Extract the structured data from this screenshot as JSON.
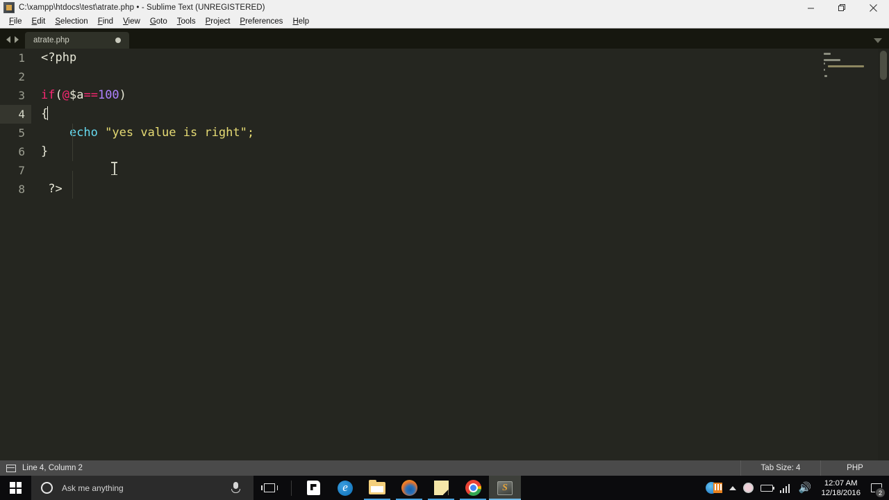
{
  "window": {
    "title": "C:\\xampp\\htdocs\\test\\atrate.php • - Sublime Text (UNREGISTERED)",
    "icon": "sublime-app-icon",
    "controls": {
      "minimize": "minimize-icon",
      "restore": "restore-icon",
      "close": "close-icon"
    }
  },
  "menu": {
    "items": [
      {
        "label": "File",
        "accel": "F",
        "rest": "ile"
      },
      {
        "label": "Edit",
        "accel": "E",
        "rest": "dit"
      },
      {
        "label": "Selection",
        "accel": "S",
        "rest": "election"
      },
      {
        "label": "Find",
        "accel": "n",
        "rest": "Find"
      },
      {
        "label": "View",
        "accel": "V",
        "rest": "iew"
      },
      {
        "label": "Goto",
        "accel": "G",
        "rest": "oto"
      },
      {
        "label": "Tools",
        "accel": "T",
        "rest": "ools"
      },
      {
        "label": "Project",
        "accel": "P",
        "rest": "roject"
      },
      {
        "label": "Preferences",
        "accel": "n",
        "rest": "Preferences"
      },
      {
        "label": "Help",
        "accel": "H",
        "rest": "elp"
      }
    ]
  },
  "tabbar": {
    "prev_arrow": "arrow-left-icon",
    "next_arrow": "arrow-right-icon",
    "dropdown": "chevron-down-icon",
    "tabs": [
      {
        "label": "atrate.php",
        "dirty": true,
        "active": true
      }
    ]
  },
  "editor": {
    "language": "PHP",
    "lines": [
      {
        "num": "1",
        "active": false,
        "indent_guide": false,
        "tokens": [
          {
            "t": "<?php",
            "c": "t-plain"
          }
        ]
      },
      {
        "num": "2",
        "active": false,
        "indent_guide": false,
        "tokens": []
      },
      {
        "num": "3",
        "active": false,
        "indent_guide": false,
        "tokens": [
          {
            "t": "if",
            "c": "t-keyword"
          },
          {
            "t": "(",
            "c": "t-punct"
          },
          {
            "t": "@",
            "c": "t-at"
          },
          {
            "t": "$a",
            "c": "t-plain"
          },
          {
            "t": "==",
            "c": "t-op"
          },
          {
            "t": "100",
            "c": "t-number"
          },
          {
            "t": ")",
            "c": "t-punct"
          }
        ]
      },
      {
        "num": "4",
        "active": true,
        "indent_guide": false,
        "caret_after": true,
        "tokens": [
          {
            "t": "{",
            "c": "t-plain"
          }
        ]
      },
      {
        "num": "5",
        "active": false,
        "indent_guide": true,
        "tokens": [
          {
            "t": "    ",
            "c": "t-plain"
          },
          {
            "t": "echo",
            "c": "t-func"
          },
          {
            "t": " ",
            "c": "t-plain"
          },
          {
            "t": "\"yes value is right\"",
            "c": "t-string"
          },
          {
            "t": ";",
            "c": "t-string"
          }
        ]
      },
      {
        "num": "6",
        "active": false,
        "indent_guide": true,
        "tokens": [
          {
            "t": "}",
            "c": "t-plain"
          }
        ]
      },
      {
        "num": "7",
        "active": false,
        "indent_guide": true,
        "tokens": []
      },
      {
        "num": "8",
        "active": false,
        "indent_guide": true,
        "tokens": [
          {
            "t": " ",
            "c": "t-plain"
          },
          {
            "t": "?>",
            "c": "t-plain"
          }
        ]
      }
    ],
    "minimap": "code-minimap",
    "scrollbar": "editor-vertical-scrollbar",
    "mouse_cursor": "text-ibeam-cursor",
    "colors": {
      "background": "#252620",
      "gutter_text": "#9d9f92",
      "active_line_gutter": "#35362e",
      "keyword": "#f92672",
      "number": "#ae81ff",
      "function": "#66d9ef",
      "string": "#e6db74",
      "plain": "#e8e8d8"
    }
  },
  "statusbar": {
    "icon": "sidebar-toggle-icon",
    "position": "Line 4, Column 2",
    "tab_size": "Tab Size: 4",
    "syntax": "PHP"
  },
  "taskbar": {
    "start": "windows-start-icon",
    "search": {
      "placeholder": "Ask me anything",
      "cortana_icon": "cortana-circle-icon",
      "mic_icon": "microphone-icon"
    },
    "task_view": "task-view-icon",
    "apps": [
      {
        "name": "store",
        "icon": "microsoft-store-icon",
        "running": false,
        "active": false
      },
      {
        "name": "edge",
        "icon": "edge-browser-icon",
        "glyph": "e",
        "running": false,
        "active": false
      },
      {
        "name": "file-explorer",
        "icon": "file-explorer-icon",
        "running": true,
        "active": false
      },
      {
        "name": "firefox",
        "icon": "firefox-browser-icon",
        "running": true,
        "active": false
      },
      {
        "name": "sticky-notes",
        "icon": "sticky-notes-icon",
        "running": true,
        "active": false
      },
      {
        "name": "chrome",
        "icon": "chrome-browser-icon",
        "running": true,
        "active": false
      },
      {
        "name": "sublime-text",
        "icon": "sublime-text-icon",
        "glyph": "S",
        "running": true,
        "active": true
      }
    ],
    "tray": {
      "globe_icon": "network-globe-icon",
      "orange_icon": "xampp-control-icon",
      "expand_icon": "show-hidden-icons-chevron",
      "safety_icon": "antivirus-shield-icon",
      "battery_icon": "battery-icon",
      "wifi_icon": "wifi-icon",
      "volume_icon": "volume-icon",
      "time": "12:07 AM",
      "date": "12/18/2016",
      "action_center_icon": "action-center-icon",
      "notification_count": "2"
    }
  }
}
